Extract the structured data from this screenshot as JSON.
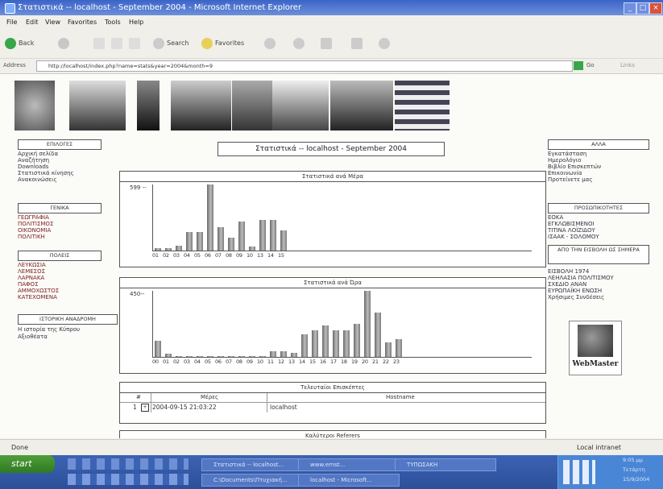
{
  "window": {
    "title": "Στατιστικά -- localhost - September 2004 - Microsoft Internet Explorer",
    "controls": [
      "_",
      "□",
      "×"
    ]
  },
  "menu": [
    "File",
    "Edit",
    "View",
    "Favorites",
    "Tools",
    "Help"
  ],
  "toolbar": {
    "back": "Back",
    "search": "Search",
    "favorites": "Favorites"
  },
  "address": {
    "label": "Address",
    "url": "http://localhost/index.php?name=stats&year=2004&month=9",
    "go": "Go",
    "links": "Links"
  },
  "left_nav": {
    "sections": [
      {
        "title": "ΕΠΙΛΟΓΕΣ",
        "items": [
          "Αρχική σελίδα",
          "Αναζήτηση",
          "Downloads",
          "Στατιστικά κίνησης",
          "Ανακοινώσεις"
        ],
        "style": "normal"
      },
      {
        "title": "ΓΕΝΙΚΑ",
        "items": [
          "ΓΕΩΓΡΑΦΙΑ",
          "ΠΟΛΙΤΙΣΜΟΣ",
          "ΟΙΚΟΝΟΜΙΑ",
          "ΠΟΛΙΤΙΚΗ"
        ],
        "style": "red"
      },
      {
        "title": "ΠΟΛΕΙΣ",
        "items": [
          "ΛΕΥΚΩΣΙΑ",
          "ΛΕΜΕΣΟΣ",
          "ΛΑΡΝΑΚΑ",
          "ΠΑΦΟΣ",
          "ΑΜΜΟΧΩΣΤΟΣ",
          "ΚΑΤΕΧΟΜΕΝΑ"
        ],
        "style": "red"
      },
      {
        "title": "ΙΣΤΟΡΙΚΗ ΑΝΑΔΡΟΜΗ",
        "items": [
          "Η ιστορία της Κύπρου",
          "Αξιοθέατα"
        ],
        "style": "normal"
      }
    ]
  },
  "right_nav": {
    "sections": [
      {
        "title": "ΑΛΛΑ",
        "items": [
          "Εγκατάσταση",
          "Ημερολόγιο",
          "Βιβλίο Επισκεπτών",
          "Επικοινωνία",
          "Προτείνετε μας"
        ]
      },
      {
        "title": "ΠΡΟΣΩΠΙΚΟΤΗΤΕΣ",
        "items": [
          "ΕΟΚΑ",
          "ΕΓΚΛΩΒΙΣΜΕΝΟΙ",
          "ΤΙΤΙΝΑ ΛΟΪΖΙΔΟΥ",
          "ΙΣΑΑΚ - ΣΟΛΟΜΟΥ"
        ]
      },
      {
        "title": "ΑΠΟ ΤΗΝ ΕΙΣΒΟΛΗ ΩΣ ΣΗΜΕΡΑ",
        "items": [
          "ΕΙΣΒΟΛΗ 1974",
          "ΛΕΗΛΑΣΙΑ ΠΟΛΙΤΙΣΜΟΥ",
          "ΣΧΕΔΙΟ ΑΝΑΝ",
          "ΕΥΡΩΠΑΪΚΗ ΕΝΩΣΗ",
          "Χρήσιμες Συνδέσεις"
        ]
      }
    ],
    "webmaster_label": "WebMaster"
  },
  "page_title": "Στατιστικά -- localhost - September 2004",
  "chart_data": [
    {
      "type": "bar",
      "title": "Στατιστικά ανά Μέρα",
      "ymax_label": "599 --",
      "ylim": [
        0,
        599
      ],
      "categories": [
        "01",
        "02",
        "03",
        "04",
        "05",
        "06",
        "07",
        "08",
        "09",
        "10",
        "13",
        "14",
        "15"
      ],
      "values": [
        25,
        25,
        45,
        165,
        165,
        599,
        215,
        120,
        260,
        35,
        275,
        275,
        180
      ]
    },
    {
      "type": "bar",
      "title": "Στατιστικά ανά Ώρα",
      "ymax_label": "450--",
      "ylim": [
        0,
        450
      ],
      "categories": [
        "00",
        "01",
        "02",
        "03",
        "04",
        "05",
        "06",
        "07",
        "08",
        "09",
        "10",
        "11",
        "12",
        "13",
        "14",
        "15",
        "16",
        "17",
        "18",
        "19",
        "20",
        "21",
        "22",
        "23"
      ],
      "values": [
        110,
        20,
        5,
        5,
        5,
        5,
        5,
        5,
        5,
        5,
        5,
        40,
        40,
        25,
        155,
        180,
        215,
        180,
        180,
        225,
        450,
        300,
        100,
        120
      ]
    }
  ],
  "last_visitors": {
    "title": "Τελευταίοι Επισκέπτες",
    "columns": [
      "#",
      "Μέρες",
      "Hostname"
    ],
    "rows": [
      {
        "n": "1",
        "date": "2004-09-15 21:03:22",
        "host": "localhost"
      }
    ]
  },
  "referers_title": "Καλύτεροι Referers",
  "status": {
    "left": "Done",
    "right": "Local intranet"
  },
  "taskbar": {
    "start": "start",
    "tasks": [
      "Στατιστικά -- localhost...",
      "www.ernst...",
      "ΤΥΠΩΣΑΚΗ",
      "C:\\Documents\\Πτυχιακή...",
      "localhost - Microsoft..."
    ],
    "tray_text": "EN",
    "clock": [
      "9:05 μμ",
      "Τετάρτη",
      "15/9/2004"
    ]
  }
}
